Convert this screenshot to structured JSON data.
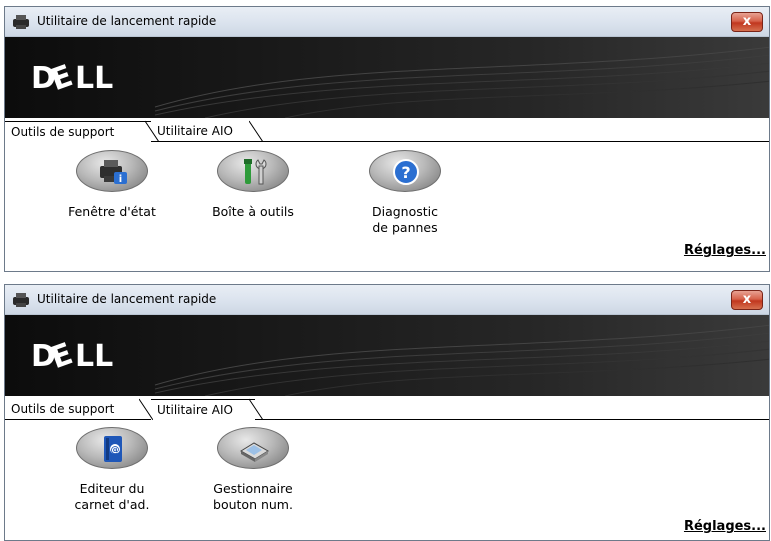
{
  "windows": [
    {
      "title": "Utilitaire de lancement rapide",
      "close_label": "x",
      "tabs": [
        "Outils de support",
        "Utilitaire AIO"
      ],
      "active_tab": 0,
      "tools": [
        {
          "label": "Fenêtre d'état",
          "icon": "printer-status-icon"
        },
        {
          "label": "Boîte à outils",
          "icon": "toolbox-icon"
        },
        {
          "label": "Diagnostic\nde pannes",
          "icon": "help-icon"
        }
      ],
      "settings_link": "Réglages..."
    },
    {
      "title": "Utilitaire de lancement rapide",
      "close_label": "x",
      "tabs": [
        "Outils de support",
        "Utilitaire AIO"
      ],
      "active_tab": 1,
      "tools": [
        {
          "label": "Editeur du\ncarnet d'ad.",
          "icon": "address-book-icon"
        },
        {
          "label": "Gestionnaire\nbouton num.",
          "icon": "scanner-icon"
        }
      ],
      "settings_link": "Réglages..."
    }
  ],
  "brand": {
    "logo_text": "DELL"
  },
  "colors": {
    "close_button": "#c1371f",
    "banner": "#1b1b1b",
    "help_blue": "#2b6fd1"
  }
}
